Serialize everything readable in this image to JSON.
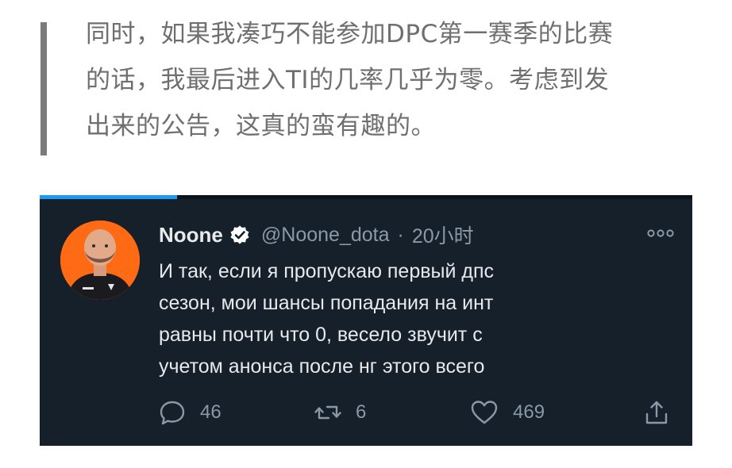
{
  "article": {
    "quote_lines": [
      "同时，如果我凑巧不能参加DPC第一赛季的比赛",
      "的话，我最后进入TI的几率几乎为零。考虑到发",
      "出来的公告，这真的蛮有趣的。"
    ]
  },
  "tweet": {
    "display_name": "Noone",
    "handle": "@Noone_dota",
    "separator": "·",
    "timestamp": "20小时",
    "body_lines": [
      "И так, если я пропускаю первый дпс",
      "сезон, мои шансы попадания на инт",
      "равны почти что 0, весело звучит с",
      "учетом анонса после нг этого всего"
    ],
    "video_progress": 0.21,
    "actions": {
      "reply_count": "46",
      "retweet_count": "6",
      "like_count": "469"
    },
    "icons": {
      "verified": "verified-badge-icon",
      "more": "more-dots-icon",
      "reply": "reply-icon",
      "retweet": "retweet-icon",
      "like": "heart-icon",
      "share": "share-icon"
    }
  },
  "colors": {
    "tweet_background": "#15202b",
    "avatar_background": "#ff6a14",
    "quote_text": "#6f6f6f",
    "quote_bar": "#7b7b7b",
    "progress_accent": "#1d9bf0",
    "secondary_text": "#8b98a5"
  }
}
